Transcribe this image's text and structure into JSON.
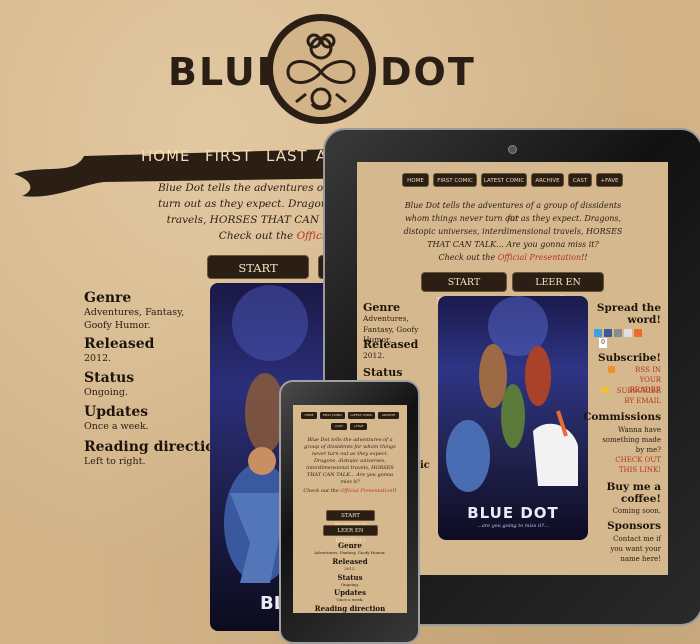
{
  "logo": {
    "left_word": "BLUE",
    "right_word": "DOT"
  },
  "nav": [
    "HOME",
    "FIRST",
    "LAST",
    "A"
  ],
  "desktop": {
    "intro_lines": [
      "Blue Dot tells the adventures of a group",
      "turn out as they expect. Dragons, di",
      "travels, HORSES THAT CAN T"
    ],
    "intro_link_prefix": "Check out the",
    "intro_link": "Offici",
    "buttons": {
      "start": "START READING!!"
    },
    "info": [
      {
        "heading": "Genre",
        "value": "Adventures, Fantasy, Goofy Humor."
      },
      {
        "heading": "Released",
        "value": "2012."
      },
      {
        "heading": "Status",
        "value": "Ongoing."
      },
      {
        "heading": "Updates",
        "value": "Once a week."
      },
      {
        "heading": "Reading direction",
        "value": "Left to right."
      }
    ],
    "poster_text": "BLUE"
  },
  "tablet": {
    "nav": [
      "HOME",
      "FIRST COMIC",
      "LATEST COMIC",
      "ARCHIVE",
      "CAST",
      "+FAVE"
    ],
    "intro_lines": [
      "Blue Dot tells the adventures of a group of dissidents for",
      "whom things never turn out as they expect. Dragons,",
      "distopic universes, interdimensional travels, HORSES",
      "THAT CAN TALK... Are you gonna miss it?"
    ],
    "intro_link_prefix": "Check out the",
    "intro_link": "Official Presentation",
    "intro_link_suffix": "!!",
    "buttons": {
      "start": "START READING!!",
      "leer": "LEER EN ESPAÑOL!"
    },
    "info": [
      {
        "heading": "Genre",
        "value": "Adventures, Fantasy, Goofy Humor."
      },
      {
        "heading": "Released",
        "value": "2012."
      },
      {
        "heading": "Status",
        "value": ""
      },
      {
        "heading": "",
        "value": "ic"
      }
    ],
    "poster_title": "BLUE DOT",
    "poster_tagline": "...are you going to miss it?...",
    "sidebar": {
      "spread_heading": "Spread the word!",
      "share_count": "0",
      "subscribe_heading": "Subscribe!",
      "rss_link": "RSS IN YOUR READER",
      "email_link": "SUBSCRIBE BY EMAIL",
      "commissions_heading": "Commissions",
      "commissions_text": "Wanna have something made by me?",
      "commissions_link": "CHECK OUT THIS LINK!",
      "coffee_heading": "Buy me a coffee!",
      "coffee_text": "Coming soon.",
      "sponsors_heading": "Sponsors",
      "sponsors_text": "Contact me if you want your name here!"
    }
  },
  "phone": {
    "nav": [
      "HOME",
      "FIRST COMIC",
      "LATEST COMIC",
      "ARCHIVE",
      "CAST",
      "+FAVE"
    ],
    "intro_lines": [
      "Blue Dot tells the adventures of a",
      "group of dissidents for whom things",
      "never turn out as they expect.",
      "Dragons, distopic universes,",
      "interdimensional travels, HORSES",
      "THAT CAN TALK... Are you gonna",
      "miss it?"
    ],
    "intro_link_prefix": "Check out the",
    "intro_link": "Official Presentation",
    "intro_link_suffix": "!!",
    "buttons": {
      "start": "START READING!!",
      "leer": "LEER EN ESPAÑOL!"
    },
    "info": [
      {
        "heading": "Genre",
        "value": "Adventures, Fantasy, Goofy Humor."
      },
      {
        "heading": "Released",
        "value": "2012."
      },
      {
        "heading": "Status",
        "value": "Ongoing."
      },
      {
        "heading": "Updates",
        "value": "Once a week."
      },
      {
        "heading": "Reading direction",
        "value": ""
      }
    ]
  },
  "colors": {
    "parchment": "#d3b489",
    "dark": "#2b1e15",
    "link_red": "#b4341f",
    "nav_text": "#f3deb4"
  }
}
